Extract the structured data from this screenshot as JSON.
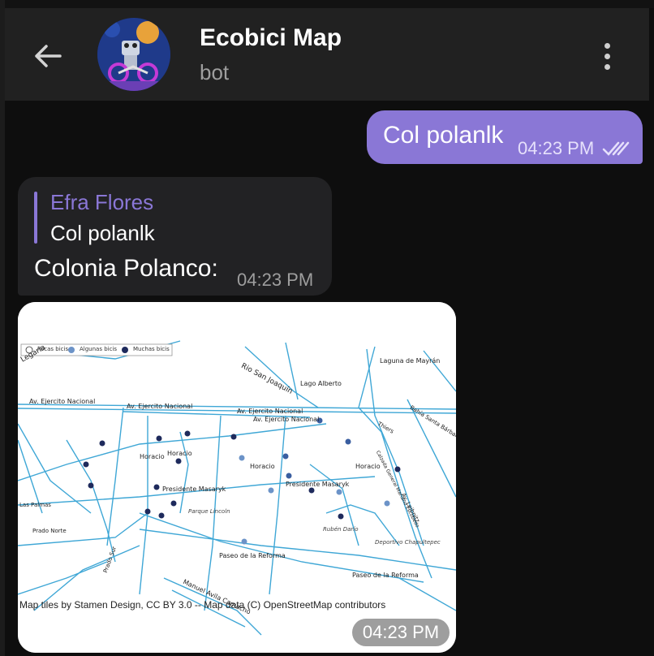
{
  "header": {
    "title": "Ecobici Map",
    "subtitle": "bot"
  },
  "messages": {
    "outgoing": {
      "text": "Col polanlk",
      "time": "04:23 PM"
    },
    "incoming": {
      "reply_author": "Efra Flores",
      "reply_text": "Col polanlk",
      "text": "Colonia Polanco:",
      "time": "04:23 PM"
    },
    "map": {
      "time": "04:23 PM",
      "attribution": "Map tiles by Stamen Design, CC BY 3.0 -- Map data (C) OpenStreetMap contributors",
      "legend": [
        "Pocas bicis",
        "Algunas bicis",
        "Muchas bicis"
      ],
      "street_labels": [
        "Legaria",
        "Rio San Joaquín",
        "Lago Alberto",
        "Laguna de Mayrán",
        "Av. Ejercito Nacional",
        "Av. Ejercito Nacional",
        "Av. Ejercito Nacional",
        "Av. Ejercito Nacional",
        "Horacio",
        "Horacio",
        "Horacio",
        "Horacio",
        "Presidente Masaryk",
        "Presidente Masaryk",
        "Parque Lincoln",
        "Rubén Darío",
        "Deportivo Chapultepec",
        "Paseo de la Reforma",
        "Paseo de la Reforma",
        "Prado Norte",
        "Las Palmas",
        "Prado Sur",
        "Manuel Avila Camacho",
        "Thiers",
        "Calzada General Mariano Escobedo",
        "Av. Leibnitz",
        "Bahía Santa Bárbara"
      ]
    }
  },
  "colors": {
    "topbar": "#212121",
    "background": "#0e0e0e",
    "outgoing_bubble": "#8a77d6",
    "incoming_bubble": "#222224",
    "accent": "#8a77d6",
    "street": "#3fa7d6",
    "dot_dark": "#1e2a5c",
    "dot_mid": "#3a5ea0",
    "dot_light": "#6c93c8"
  },
  "icons": {
    "back": "arrow-left-icon",
    "menu": "more-vertical-icon",
    "read": "double-check-icon"
  }
}
